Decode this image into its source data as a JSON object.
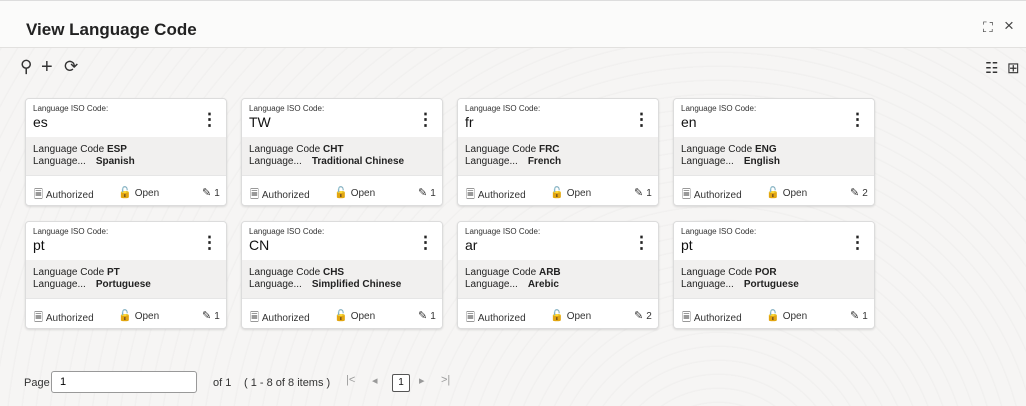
{
  "header": {
    "title": "View Language Code",
    "expand_icon": "⛶",
    "close_icon": "×"
  },
  "toolbar": {
    "search_icon": "⚲",
    "add_icon": "+",
    "refresh_icon": "⟳",
    "list_view_icon": "☷",
    "grid_view_icon": "⊞"
  },
  "labels": {
    "iso": "Language ISO Code:",
    "code": "Language Code",
    "lang": "Language..."
  },
  "cards": [
    {
      "iso": "es",
      "code": "ESP",
      "language": "Spanish",
      "status": "Authorized",
      "lock": "Open",
      "edits": "1"
    },
    {
      "iso": "TW",
      "code": "CHT",
      "language": "Traditional Chinese",
      "status": "Authorized",
      "lock": "Open",
      "edits": "1"
    },
    {
      "iso": "fr",
      "code": "FRC",
      "language": "French",
      "status": "Authorized",
      "lock": "Open",
      "edits": "1"
    },
    {
      "iso": "en",
      "code": "ENG",
      "language": "English",
      "status": "Authorized",
      "lock": "Open",
      "edits": "2"
    },
    {
      "iso": "pt",
      "code": "PT",
      "language": "Portuguese",
      "status": "Authorized",
      "lock": "Open",
      "edits": "1"
    },
    {
      "iso": "CN",
      "code": "CHS",
      "language": "Simplified Chinese",
      "status": "Authorized",
      "lock": "Open",
      "edits": "1"
    },
    {
      "iso": "ar",
      "code": "ARB",
      "language": "Arebic",
      "status": "Authorized",
      "lock": "Open",
      "edits": "2"
    },
    {
      "iso": "pt",
      "code": "POR",
      "language": "Portuguese",
      "status": "Authorized",
      "lock": "Open",
      "edits": "1"
    }
  ],
  "pager": {
    "page_label": "Page",
    "page_value": "1",
    "of_label": "of 1",
    "items_label": "( 1 - 8 of 8 items )",
    "first": "|<",
    "prev": "◂",
    "current": "1",
    "next": "▸",
    "last": ">|"
  }
}
